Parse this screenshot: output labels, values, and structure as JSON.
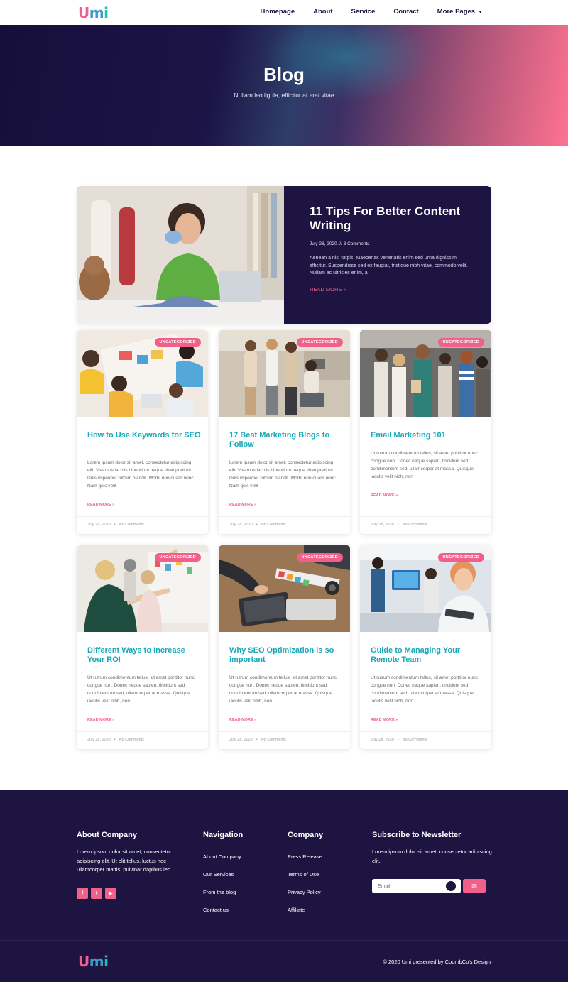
{
  "header": {
    "logo": [
      "U",
      "m",
      "i"
    ],
    "nav": [
      "Homepage",
      "About",
      "Service",
      "Contact",
      "More Pages"
    ]
  },
  "hero": {
    "title": "Blog",
    "subtitle": "Nullam leo ligula, efficitur at erat vitae"
  },
  "featured": {
    "title": "11 Tips For Better Content Writing",
    "meta": "July 28, 2020 /// 3 Comments",
    "excerpt": "Aenean a nisi turpis. Maecenas venenatis enim sed urna dignissim efficitur. Suspendisse sed ex feugiat, tristique nibh vitae, commodo velit. Nullam ac ultricies enim, a",
    "more": "READ MORE »"
  },
  "posts": [
    {
      "badge": "UNCATEGORIZED",
      "title": "How to Use Keywords for SEO",
      "excerpt": "Lorem ipsum dolor sit amet, consectetur adipiscing elit. Vivamus iaculis bibendum neque vitae pretium. Duis imperdiet rutrum blandit. Morbi non quam nunc. Nam quis velit",
      "more": "READ MORE »",
      "date": "July 28, 2020",
      "comments": "No Comments"
    },
    {
      "badge": "UNCATEGORIZED",
      "title": "17 Best Marketing Blogs to Follow",
      "excerpt": "Lorem ipsum dolor sit amet, consectetur adipiscing elit. Vivamus iaculis bibendum neque vitae pretium. Duis imperdiet rutrum blandit. Morbi non quam nunc. Nam quis velit",
      "more": "READ MORE »",
      "date": "July 28, 2020",
      "comments": "No Comments"
    },
    {
      "badge": "UNCATEGORIZED",
      "title": "Email Marketing 101",
      "excerpt": "Ut rutrum condimentum tellus, sit amet porttitor nunc congue non. Donec neque sapien, tincidunt sed condimentum sed, ullamcorper at massa. Quisque iaculis velit nibh, non",
      "more": "READ MORE »",
      "date": "July 28, 2020",
      "comments": "No Comments"
    },
    {
      "badge": "UNCATEGORIZED",
      "title": "Different Ways to Increase Your ROI",
      "excerpt": "Ut rutrum condimentum tellus, sit amet porttitor nunc congue non. Donec neque sapien, tincidunt sed condimentum sed, ullamcorper at massa. Quisque iaculis velit nibh, non",
      "more": "READ MORE »",
      "date": "July 28, 2020",
      "comments": "No Comments"
    },
    {
      "badge": "UNCATEGORIZED",
      "title": "Why SEO Optimization is so important",
      "excerpt": "Ut rutrum condimentum tellus, sit amet porttitor nunc congue non. Donec neque sapien, tincidunt sed condimentum sed, ullamcorper at massa. Quisque iaculis velit nibh, non",
      "more": "READ MORE »",
      "date": "July 28, 2020",
      "comments": "No Comments"
    },
    {
      "badge": "UNCATEGORIZED",
      "title": "Guide to Managing Your Remote Team",
      "excerpt": "Ut rutrum condimentum tellus, sit amet porttitor nunc congue non. Donec neque sapien, tincidunt sed condimentum sed, ullamcorper at massa. Quisque iaculis velit nibh, non",
      "more": "READ MORE »",
      "date": "July 28, 2020",
      "comments": "No Comments"
    }
  ],
  "footer": {
    "about_title": "About Company",
    "about_text": "Lorem ipsum dolor sit amet, consectetur adipiscing elit. Ut elit tellus, luctus nec ullamcorper mattis, pulvinar dapibus leo.",
    "nav_title": "Navigation",
    "nav_links": [
      "About Company",
      "Our Services",
      "From the blog",
      "Contact us"
    ],
    "company_title": "Company",
    "company_links": [
      "Press Release",
      "Terms of Use",
      "Privacy Policy",
      "Affiliate"
    ],
    "newsletter_title": "Subscribe to Newsletter",
    "newsletter_text": "Lorem ipsum dolor sit amet, consectetur adipiscing elit.",
    "email_placeholder": "Email",
    "copyright": "© 2020 Umi presented by CoombCo's Design"
  }
}
